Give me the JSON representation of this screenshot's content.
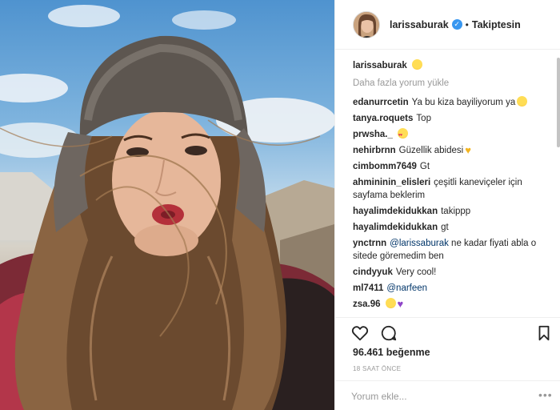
{
  "post": {
    "photo_alt": "selfie photo",
    "author": {
      "username": "larissaburak",
      "verified": true,
      "follow_state": "Takiptesin",
      "separator": "•"
    },
    "caption": {
      "username": "larissaburak"
    },
    "load_more": "Daha fazla yorum yükle",
    "comments": [
      {
        "username": "edanurrcetin",
        "text": "Ya bu kiza bayiliyorum ya",
        "emoji": "smile"
      },
      {
        "username": "tanya.roquets",
        "text": "Top"
      },
      {
        "username": "prwsha._",
        "text": "",
        "emoji": "heart-eyes"
      },
      {
        "username": "nehirbrnn",
        "text": "Güzellik abidesi",
        "emoji": "yellow-heart"
      },
      {
        "username": "cimbomm7649",
        "text": "Gt"
      },
      {
        "username": "ahmininin_elisleri",
        "text": "çeşitli kaneviçeler için sayfama beklerim"
      },
      {
        "username": "hayalimdekidukkan",
        "text": "takippp"
      },
      {
        "username": "hayalimdekidukkan",
        "text": "gt"
      },
      {
        "username": "ynctrnn",
        "mention": "@larissaburak",
        "text": "ne kadar fiyati abla o sitede göremedim ben"
      },
      {
        "username": "cindyyuk",
        "text": "Very cool!"
      },
      {
        "username": "ml7411",
        "mention": "@narfeen",
        "text": ""
      },
      {
        "username": "zsa.96",
        "text": "",
        "emoji": "smile-purple-heart"
      }
    ],
    "likes": "96.461 beğenme",
    "time": "18 SAAT ÖNCE",
    "add_comment_placeholder": "Yorum ekle...",
    "more_options": "•••"
  },
  "colors": {
    "accent": "#3897f0",
    "text": "#262626",
    "muted": "#999999",
    "border": "#efefef",
    "mention": "#003569"
  },
  "icons": {
    "like": "heart-outline-icon",
    "comment": "speech-bubble-icon",
    "save": "bookmark-icon",
    "verified": "verified-badge-icon"
  }
}
